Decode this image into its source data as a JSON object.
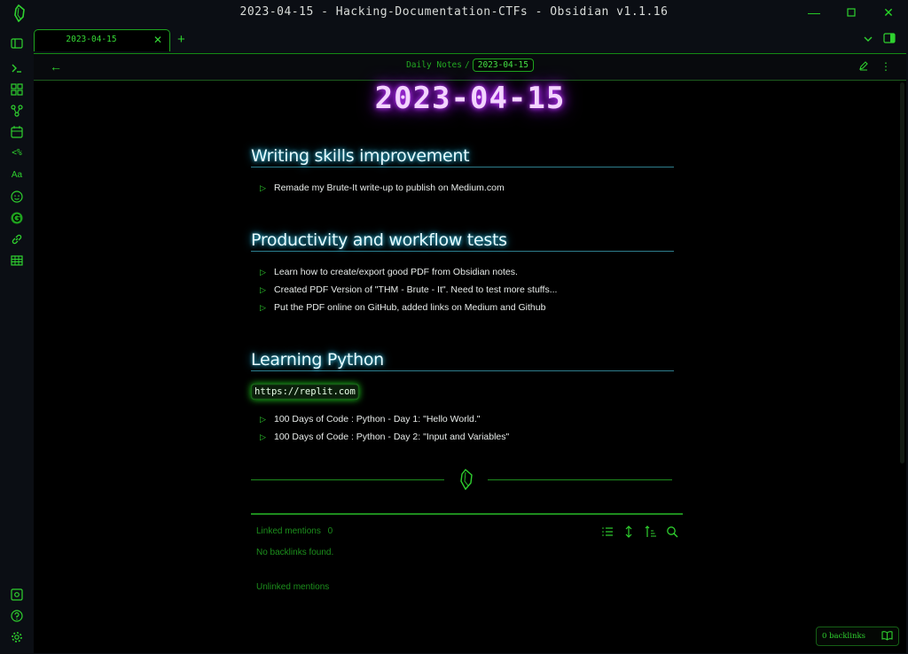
{
  "window": {
    "title": "2023-04-15 - Hacking-Documentation-CTFs - Obsidian v1.1.16",
    "logo_icon": "obsidian-logo-icon",
    "controls": [
      "minimize-icon",
      "maximize-icon",
      "close-icon"
    ]
  },
  "ribbon": {
    "top_icons": [
      "sidebar-toggle-icon",
      "terminal-icon",
      "command-palette-icon",
      "graph-icon",
      "calendar-icon",
      "templater-icon",
      "font-icon",
      "emoji-icon",
      "grammarly-icon",
      "link-icon",
      "table-icon"
    ],
    "bottom_icons": [
      "vault-switch-icon",
      "help-icon",
      "settings-icon"
    ]
  },
  "tabs": {
    "active_label": "2023-04-15",
    "new_tab_icon": "plus-icon",
    "right_icons": [
      "chevron-down-icon",
      "sidebar-right-icon"
    ]
  },
  "view_header": {
    "breadcrumb_parent": "Daily Notes",
    "breadcrumb_sep": "/",
    "breadcrumb_current": "2023-04-15",
    "actions": [
      "edit-icon",
      "more-options-icon"
    ]
  },
  "note": {
    "title": "2023-04-15",
    "sections": [
      {
        "heading": "Writing skills improvement",
        "items": [
          "Remade my Brute-It write-up to publish on Medium.com"
        ]
      },
      {
        "heading": "Productivity and workflow tests",
        "items": [
          "Learn how to create/export good PDF from Obsidian notes.",
          "Created PDF Version of \"THM - Brute - It\". Need to test more stuffs...",
          "Put the PDF online on GitHub, added links on Medium and Github"
        ]
      },
      {
        "heading": "Learning Python",
        "link": "https://replit.com",
        "items": [
          "100 Days of Code : Python - Day 1: \"Hello World.\"",
          "100 Days of Code : Python - Day 2: \"Input and Variables\""
        ]
      }
    ]
  },
  "backlinks": {
    "linked_label": "Linked mentions",
    "linked_count": "0",
    "no_backlinks": "No backlinks found.",
    "unlinked_label": "Unlinked mentions",
    "tools": [
      "list-icon",
      "sort-collapse-icon",
      "sort-order-icon",
      "search-icon"
    ]
  },
  "status_bar": {
    "backlinks": "0 backlinks",
    "icon": "book-open-icon"
  },
  "colors": {
    "accent": "#2fd12f",
    "title_glow": "#b026ff",
    "heading_glow": "#3cc7e8",
    "background": "#000000"
  }
}
